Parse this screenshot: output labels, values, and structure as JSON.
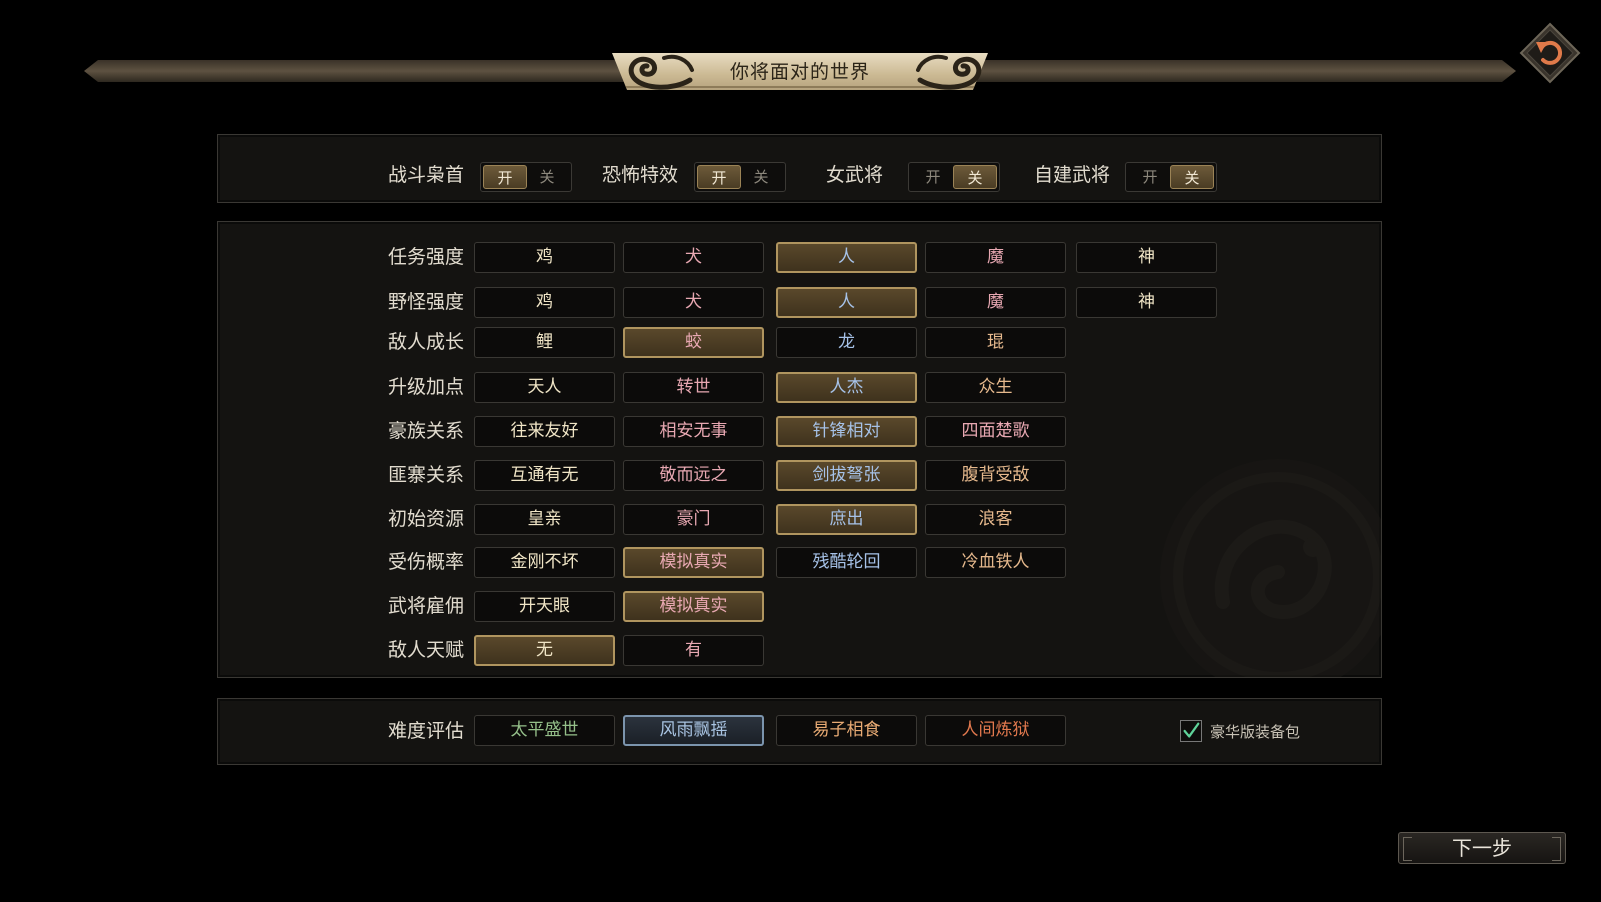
{
  "header": {
    "title": "你将面对的世界"
  },
  "toggles": [
    {
      "label": "战斗枭首",
      "on_label": "开",
      "off_label": "关",
      "value": "on"
    },
    {
      "label": "恐怖特效",
      "on_label": "开",
      "off_label": "关",
      "value": "on"
    },
    {
      "label": "女武将",
      "on_label": "开",
      "off_label": "关",
      "value": "off"
    },
    {
      "label": "自建武将",
      "on_label": "开",
      "off_label": "关",
      "value": "off"
    }
  ],
  "settings": [
    {
      "label": "任务强度",
      "options": [
        "鸡",
        "犬",
        "人",
        "魔",
        "神"
      ],
      "selected": 2
    },
    {
      "label": "野怪强度",
      "options": [
        "鸡",
        "犬",
        "人",
        "魔",
        "神"
      ],
      "selected": 2
    },
    {
      "label": "敌人成长",
      "options": [
        "鲤",
        "蛟",
        "龙",
        "琨"
      ],
      "selected": 1
    },
    {
      "label": "升级加点",
      "options": [
        "天人",
        "转世",
        "人杰",
        "众生"
      ],
      "selected": 2
    },
    {
      "label": "豪族关系",
      "options": [
        "往来友好",
        "相安无事",
        "针锋相对",
        "四面楚歌"
      ],
      "selected": 2
    },
    {
      "label": "匪寨关系",
      "options": [
        "互通有无",
        "敬而远之",
        "剑拔弩张",
        "腹背受敌"
      ],
      "selected": 2
    },
    {
      "label": "初始资源",
      "options": [
        "皇亲",
        "豪门",
        "庶出",
        "浪客"
      ],
      "selected": 2
    },
    {
      "label": "受伤概率",
      "options": [
        "金刚不坏",
        "模拟真实",
        "残酷轮回",
        "冷血铁人"
      ],
      "selected": 1
    },
    {
      "label": "武将雇佣",
      "options": [
        "开天眼",
        "模拟真实"
      ],
      "selected": 1
    },
    {
      "label": "敌人天赋",
      "options": [
        "无",
        "有"
      ],
      "selected": 0
    }
  ],
  "difficulty": {
    "label": "难度评估",
    "options": [
      "太平盛世",
      "风雨飘摇",
      "易子相食",
      "人间炼狱"
    ],
    "selected": 1,
    "colors": [
      "#95c08a",
      "#a9c4e2",
      "#e9ab74",
      "#e3794e"
    ]
  },
  "deluxe_pack": {
    "label": "豪华版装备包",
    "checked": true
  },
  "next_button": {
    "label": "下一步"
  },
  "icons": {
    "back": "undo-arrow-icon",
    "check": "check-icon"
  },
  "colors": {
    "accent_gold": "#b0955f",
    "background": "#000000",
    "panel": "#141311"
  }
}
